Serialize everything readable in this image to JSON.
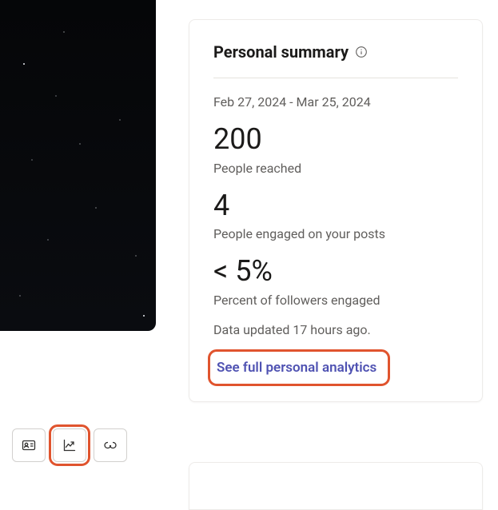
{
  "summary": {
    "title": "Personal summary",
    "date_range": "Feb 27, 2024 - Mar 25, 2024",
    "metrics": {
      "reached": {
        "value": "200",
        "label": "People reached"
      },
      "engaged": {
        "value": "4",
        "label": "People engaged on your posts"
      },
      "percent": {
        "value": "< 5%",
        "label": "Percent of followers engaged"
      }
    },
    "updated": "Data updated 17 hours ago.",
    "link": "See full personal analytics"
  }
}
